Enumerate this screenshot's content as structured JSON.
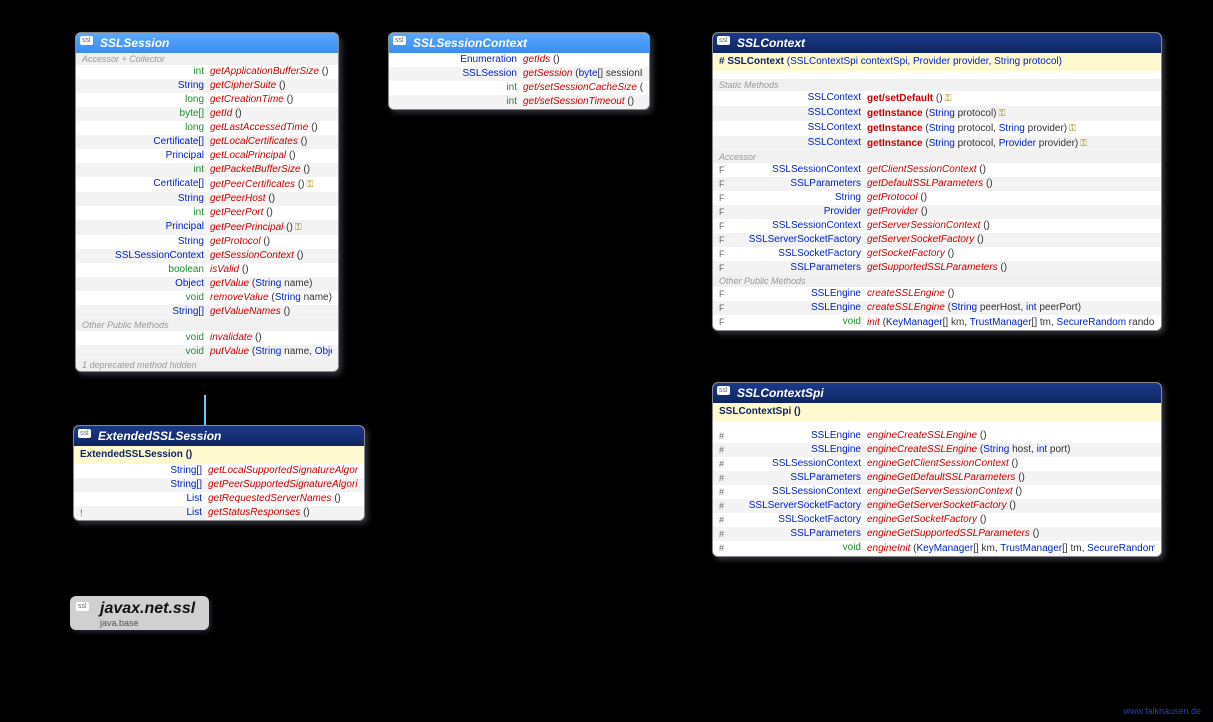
{
  "package": {
    "name": "javax.net.ssl",
    "module": "java.base"
  },
  "watermark": "www.falkhausen.de",
  "sslsession": {
    "title": "SSLSession",
    "sec1": "Accessor + Collector",
    "rows": [
      {
        "ret": "int",
        "rt": "t-int",
        "m": "getApplicationBufferSize",
        "p": "()"
      },
      {
        "ret": "String",
        "rt": "t-String",
        "m": "getCipherSuite",
        "p": "()"
      },
      {
        "ret": "long",
        "rt": "t-long",
        "m": "getCreationTime",
        "p": "()"
      },
      {
        "ret": "byte[]",
        "rt": "t-prim",
        "m": "getId",
        "p": "()"
      },
      {
        "ret": "long",
        "rt": "t-long",
        "m": "getLastAccessedTime",
        "p": "()"
      },
      {
        "ret": "Certificate[]",
        "rt": "t-obj",
        "m": "getLocalCertificates",
        "p": "()"
      },
      {
        "ret": "Principal",
        "rt": "t-obj",
        "m": "getLocalPrincipal",
        "p": "()"
      },
      {
        "ret": "int",
        "rt": "t-int",
        "m": "getPacketBufferSize",
        "p": "()"
      },
      {
        "ret": "Certificate[]",
        "rt": "t-obj",
        "m": "getPeerCertificates",
        "p": "()",
        "lock": true
      },
      {
        "ret": "String",
        "rt": "t-String",
        "m": "getPeerHost",
        "p": "()"
      },
      {
        "ret": "int",
        "rt": "t-int",
        "m": "getPeerPort",
        "p": "()"
      },
      {
        "ret": "Principal",
        "rt": "t-obj",
        "m": "getPeerPrincipal",
        "p": "()",
        "lock": true
      },
      {
        "ret": "String",
        "rt": "t-String",
        "m": "getProtocol",
        "p": "()"
      },
      {
        "ret": "SSLSessionContext",
        "rt": "t-obj",
        "m": "getSessionContext",
        "p": "()"
      },
      {
        "ret": "boolean",
        "rt": "t-bool",
        "m": "isValid",
        "p": "()"
      },
      {
        "ret": "Object",
        "rt": "t-obj",
        "m": "getValue",
        "p": "(String name)"
      },
      {
        "ret": "void",
        "rt": "t-void",
        "m": "removeValue",
        "p": "(String name)"
      },
      {
        "ret": "String[]",
        "rt": "t-String",
        "m": "getValueNames",
        "p": "()"
      }
    ],
    "sec2": "Other Public Methods",
    "rows2": [
      {
        "ret": "void",
        "rt": "t-void",
        "m": "invalidate",
        "p": "()"
      },
      {
        "ret": "void",
        "rt": "t-void",
        "m": "putValue",
        "p": "(String name, Object value)"
      }
    ],
    "foot": "1 deprecated method hidden"
  },
  "extssl": {
    "title": "ExtendedSSLSession",
    "ctor": "ExtendedSSLSession ()",
    "rows": [
      {
        "mk": "",
        "ret": "String[]",
        "rt": "t-String",
        "m": "getLocalSupportedSignatureAlgorithms",
        "p": "()"
      },
      {
        "mk": "",
        "ret": "String[]",
        "rt": "t-String",
        "m": "getPeerSupportedSignatureAlgorithms",
        "p": "()"
      },
      {
        "mk": "",
        "ret": "List<SNIServerName>",
        "rt": "t-obj",
        "m": "getRequestedServerNames",
        "p": "()"
      },
      {
        "mk": "!",
        "ret": "List<byte[]>",
        "rt": "t-obj",
        "m": "getStatusResponses",
        "p": "()"
      }
    ]
  },
  "sessionctx": {
    "title": "SSLSessionContext",
    "rows": [
      {
        "ret": "Enumeration<byte[]>",
        "rt": "t-obj",
        "m": "getIds",
        "p": "()"
      },
      {
        "ret": "SSLSession",
        "rt": "t-obj",
        "m": "getSession",
        "p": "(byte[] sessionId)"
      },
      {
        "ret": "int",
        "rt": "t-int",
        "m": "get/setSessionCacheSize",
        "p": "()"
      },
      {
        "ret": "int",
        "rt": "t-int",
        "m": "get/setSessionTimeout",
        "p": "()"
      }
    ]
  },
  "sslcontext": {
    "title": "SSLContext",
    "ctor_pre": "# SSLContext",
    "ctor_p": "(SSLContextSpi contextSpi, Provider provider, String protocol)",
    "sec1": "Static Methods",
    "rows1": [
      {
        "ret": "SSLContext",
        "rt": "t-obj",
        "m": "get/setDefault",
        "p": "()",
        "lock": true,
        "bold": true
      },
      {
        "ret": "SSLContext",
        "rt": "t-obj",
        "m": "getInstance",
        "p": "(String protocol)",
        "lock": true,
        "bold": true
      },
      {
        "ret": "SSLContext",
        "rt": "t-obj",
        "m": "getInstance",
        "p": "(String protocol, String provider)",
        "lock": true,
        "bold": true
      },
      {
        "ret": "SSLContext",
        "rt": "t-obj",
        "m": "getInstance",
        "p": "(String protocol, Provider provider)",
        "lock": true,
        "bold": true
      }
    ],
    "sec2": "Accessor",
    "rows2": [
      {
        "mk": "F",
        "ret": "SSLSessionContext",
        "rt": "t-obj",
        "m": "getClientSessionContext",
        "p": "()"
      },
      {
        "mk": "F",
        "ret": "SSLParameters",
        "rt": "t-obj",
        "m": "getDefaultSSLParameters",
        "p": "()"
      },
      {
        "mk": "F",
        "ret": "String",
        "rt": "t-String",
        "m": "getProtocol",
        "p": "()"
      },
      {
        "mk": "F",
        "ret": "Provider",
        "rt": "t-obj",
        "m": "getProvider",
        "p": "()"
      },
      {
        "mk": "F",
        "ret": "SSLSessionContext",
        "rt": "t-obj",
        "m": "getServerSessionContext",
        "p": "()"
      },
      {
        "mk": "F",
        "ret": "SSLServerSocketFactory",
        "rt": "t-obj",
        "m": "getServerSocketFactory",
        "p": "()"
      },
      {
        "mk": "F",
        "ret": "SSLSocketFactory",
        "rt": "t-obj",
        "m": "getSocketFactory",
        "p": "()"
      },
      {
        "mk": "F",
        "ret": "SSLParameters",
        "rt": "t-obj",
        "m": "getSupportedSSLParameters",
        "p": "()"
      }
    ],
    "sec3": "Other Public Methods",
    "rows3": [
      {
        "mk": "F",
        "ret": "SSLEngine",
        "rt": "t-obj",
        "m": "createSSLEngine",
        "p": "()"
      },
      {
        "mk": "F",
        "ret": "SSLEngine",
        "rt": "t-obj",
        "m": "createSSLEngine",
        "p": "(String peerHost, int peerPort)"
      },
      {
        "mk": "F",
        "ret": "void",
        "rt": "t-void",
        "m": "init",
        "p": "(KeyManager[] km, TrustManager[] tm, SecureRandom random)",
        "lock": true
      }
    ]
  },
  "sslcontextspi": {
    "title": "SSLContextSpi",
    "ctor": "SSLContextSpi ()",
    "rows": [
      {
        "mk": "#",
        "ret": "SSLEngine",
        "rt": "t-obj",
        "m": "engineCreateSSLEngine",
        "p": "()"
      },
      {
        "mk": "#",
        "ret": "SSLEngine",
        "rt": "t-obj",
        "m": "engineCreateSSLEngine",
        "p": "(String host, int port)"
      },
      {
        "mk": "#",
        "ret": "SSLSessionContext",
        "rt": "t-obj",
        "m": "engineGetClientSessionContext",
        "p": "()"
      },
      {
        "mk": "#",
        "ret": "SSLParameters",
        "rt": "t-obj",
        "m": "engineGetDefaultSSLParameters",
        "p": "()"
      },
      {
        "mk": "#",
        "ret": "SSLSessionContext",
        "rt": "t-obj",
        "m": "engineGetServerSessionContext",
        "p": "()"
      },
      {
        "mk": "#",
        "ret": "SSLServerSocketFactory",
        "rt": "t-obj",
        "m": "engineGetServerSocketFactory",
        "p": "()"
      },
      {
        "mk": "#",
        "ret": "SSLSocketFactory",
        "rt": "t-obj",
        "m": "engineGetSocketFactory",
        "p": "()"
      },
      {
        "mk": "#",
        "ret": "SSLParameters",
        "rt": "t-obj",
        "m": "engineGetSupportedSSLParameters",
        "p": "()"
      },
      {
        "mk": "#",
        "ret": "void",
        "rt": "t-void",
        "m": "engineInit",
        "p": "(KeyManager[] km, TrustManager[] tm, SecureRandom sr)",
        "lock": true
      }
    ]
  }
}
